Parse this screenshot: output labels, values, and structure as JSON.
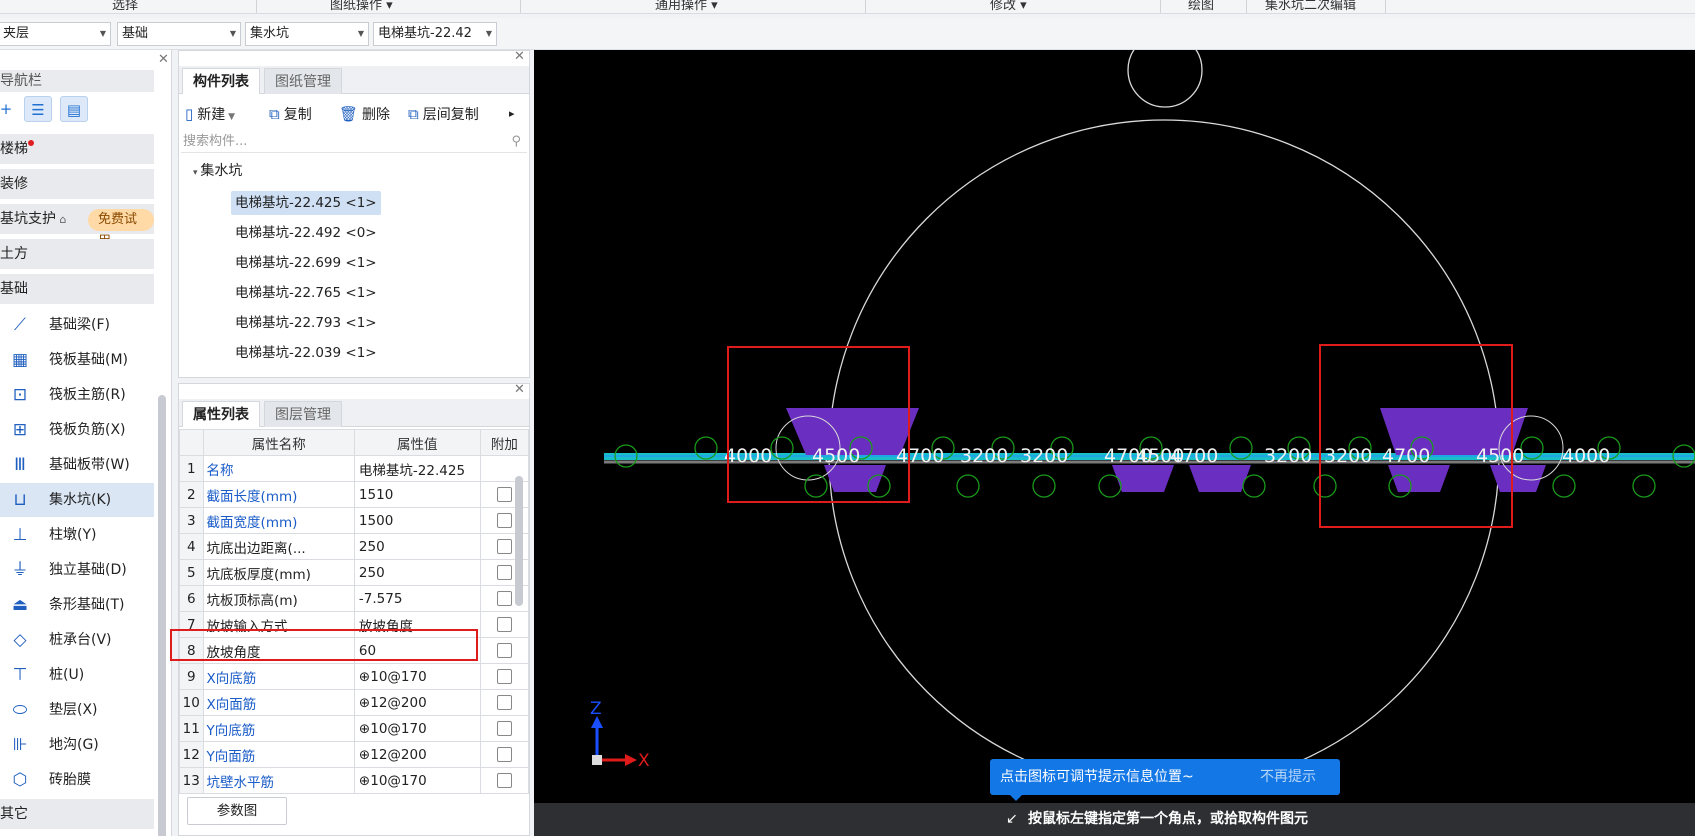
{
  "ribbon": {
    "groups": [
      "选择",
      "图纸操作 ▾",
      "通用操作 ▾",
      "修改 ▾",
      "绘图",
      "集水坑二次编辑"
    ]
  },
  "selectors": {
    "floor": "夹层",
    "category": "基础",
    "type": "集水坑",
    "component": "电梯基坑-22.42"
  },
  "nav": {
    "title": "导航栏",
    "categories": {
      "stairs": "楼梯",
      "decoration": "装修",
      "pit_support": "基坑支护",
      "pit_support_badge": "免费试用",
      "earthwork": "土方",
      "foundation": "基础",
      "other": "其它"
    },
    "items": [
      {
        "label": "基础梁(F)",
        "icon": "foundation-beam-icon"
      },
      {
        "label": "筏板基础(M)",
        "icon": "raft-foundation-icon"
      },
      {
        "label": "筏板主筋(R)",
        "icon": "raft-main-rebar-icon"
      },
      {
        "label": "筏板负筋(X)",
        "icon": "raft-negative-rebar-icon"
      },
      {
        "label": "基础板带(W)",
        "icon": "foundation-strip-icon"
      },
      {
        "label": "集水坑(K)",
        "icon": "sump-pit-icon"
      },
      {
        "label": "柱墩(Y)",
        "icon": "column-pier-icon"
      },
      {
        "label": "独立基础(D)",
        "icon": "isolated-footing-icon"
      },
      {
        "label": "条形基础(T)",
        "icon": "strip-footing-icon"
      },
      {
        "label": "桩承台(V)",
        "icon": "pile-cap-icon"
      },
      {
        "label": "桩(U)",
        "icon": "pile-icon"
      },
      {
        "label": "垫层(X)",
        "icon": "cushion-icon"
      },
      {
        "label": "地沟(G)",
        "icon": "trench-icon"
      },
      {
        "label": "砖胎膜",
        "icon": "brick-mold-icon"
      }
    ],
    "selected_item": "集水坑(K)"
  },
  "component_panel": {
    "tabs": [
      "构件列表",
      "图纸管理"
    ],
    "toolbar": {
      "new": "新建",
      "copy": "复制",
      "delete": "删除",
      "floor_copy": "层间复制"
    },
    "search_placeholder": "搜索构件...",
    "tree_root": "集水坑",
    "items": [
      "电梯基坑-22.425 <1>",
      "电梯基坑-22.492 <0>",
      "电梯基坑-22.699 <1>",
      "电梯基坑-22.765 <1>",
      "电梯基坑-22.793 <1>",
      "电梯基坑-22.039 <1>"
    ],
    "selected_index": 0
  },
  "property_panel": {
    "tabs": [
      "属性列表",
      "图层管理"
    ],
    "headers": [
      "属性名称",
      "属性值",
      "附加"
    ],
    "rows": [
      {
        "num": "1",
        "name": "名称",
        "value": "电梯基坑-22.425",
        "blue": true,
        "check": false
      },
      {
        "num": "2",
        "name": "截面长度(mm)",
        "value": "1510",
        "blue": true,
        "check": true
      },
      {
        "num": "3",
        "name": "截面宽度(mm)",
        "value": "1500",
        "blue": true,
        "check": true
      },
      {
        "num": "4",
        "name": "坑底出边距离(...",
        "value": "250",
        "blue": false,
        "check": true
      },
      {
        "num": "5",
        "name": "坑底板厚度(mm)",
        "value": "250",
        "blue": false,
        "check": true
      },
      {
        "num": "6",
        "name": "坑板顶标高(m)",
        "value": "-7.575",
        "blue": false,
        "check": true
      },
      {
        "num": "7",
        "name": "放坡输入方式",
        "value": "放坡角度",
        "blue": false,
        "check": true
      },
      {
        "num": "8",
        "name": "放坡角度",
        "value": "60",
        "blue": false,
        "check": true
      },
      {
        "num": "9",
        "name": "X向底筋",
        "value": "⊕10@170",
        "blue": true,
        "check": true
      },
      {
        "num": "10",
        "name": "X向面筋",
        "value": "⊕12@200",
        "blue": true,
        "check": true
      },
      {
        "num": "11",
        "name": "Y向底筋",
        "value": "⊕10@170",
        "blue": true,
        "check": true
      },
      {
        "num": "12",
        "name": "Y向面筋",
        "value": "⊕12@200",
        "blue": true,
        "check": true
      },
      {
        "num": "13",
        "name": "坑壁水平筋",
        "value": "⊕10@170",
        "blue": true,
        "check": true
      }
    ],
    "param_button": "参数图"
  },
  "canvas": {
    "axis_x": "X",
    "axis_z": "Z",
    "tip_text": "点击图标可调节提示信息位置~",
    "tip_dismiss": "不再提示",
    "status_text": "按鼠标左键指定第一个角点，或拾取构件图元",
    "dim_labels": [
      "4000",
      "4500",
      "4700",
      "3200",
      "3200",
      "4700",
      "4500",
      "4700",
      "3200",
      "3200",
      "4700",
      "4500",
      "4000"
    ]
  },
  "colors": {
    "accent": "#1477e6",
    "highlight": "#e01b1b",
    "pit": "#6a2fc0",
    "beam": "#00d7e6",
    "canvas": "#000000"
  }
}
